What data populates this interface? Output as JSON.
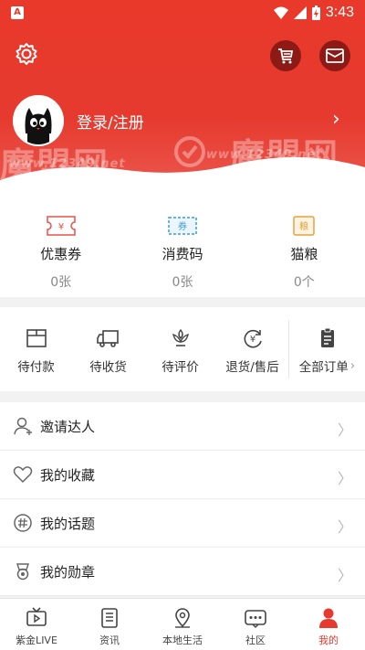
{
  "status_bar": {
    "time": "3:43",
    "app_badge": "A"
  },
  "colors": {
    "brand": "#e63a2f",
    "dark_brand": "#8e1a16"
  },
  "header": {
    "login_label": "登录/注册",
    "arrow": "›"
  },
  "watermark": {
    "big": "魔盟网",
    "small": "www.12349.net"
  },
  "coupons": [
    {
      "label": "优惠券",
      "count": "0张",
      "icon_text": "¥",
      "color": "#e9514b",
      "icon": "coupon-icon"
    },
    {
      "label": "消费码",
      "count": "0张",
      "icon_text": "券",
      "color": "#3a9ad9",
      "icon": "voucher-icon"
    },
    {
      "label": "猫粮",
      "count": "0个",
      "icon_text": "粮",
      "color": "#e8a23a",
      "icon": "cat-food-icon"
    }
  ],
  "orders": [
    {
      "label": "待付款",
      "icon": "wallet-icon"
    },
    {
      "label": "待收货",
      "icon": "truck-icon"
    },
    {
      "label": "待评价",
      "icon": "review-icon"
    },
    {
      "label": "退货/售后",
      "icon": "refund-icon"
    },
    {
      "label": "全部订单",
      "icon": "clipboard-icon"
    }
  ],
  "menu": [
    {
      "label": "邀请达人",
      "icon": "user-icon"
    },
    {
      "label": "我的收藏",
      "icon": "heart-icon"
    },
    {
      "label": "我的话题",
      "icon": "hashtag-icon"
    },
    {
      "label": "我的勋章",
      "icon": "medal-icon"
    }
  ],
  "tabs": [
    {
      "label": "紫金LIVE",
      "icon": "tv-icon"
    },
    {
      "label": "资讯",
      "icon": "news-icon"
    },
    {
      "label": "本地生活",
      "icon": "location-icon"
    },
    {
      "label": "社区",
      "icon": "community-icon"
    },
    {
      "label": "我的",
      "icon": "profile-icon",
      "active": true
    }
  ]
}
